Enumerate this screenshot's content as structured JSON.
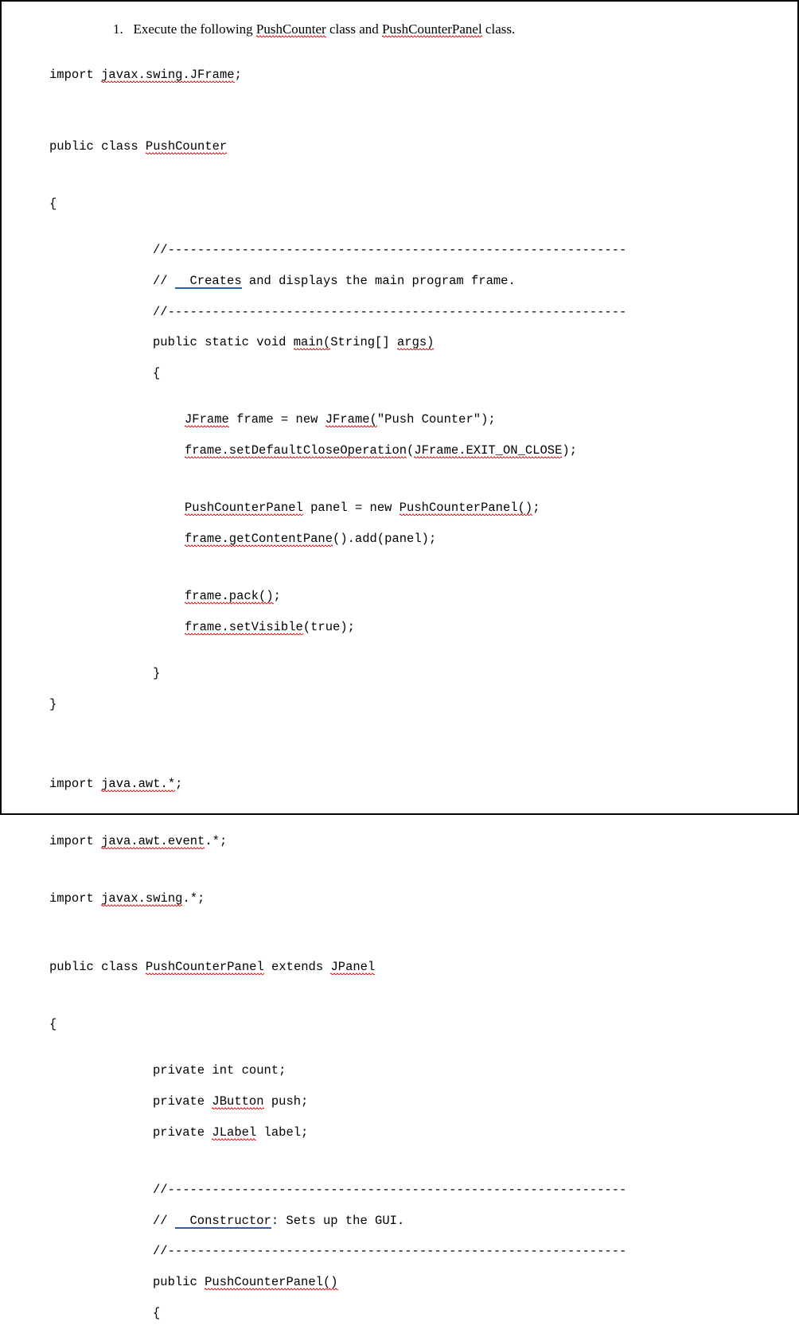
{
  "instruction_number": "1.",
  "instruction_prefix": "Execute the following ",
  "instruction_class1": "PushCounter",
  "instruction_mid": " class and ",
  "instruction_class2": "PushCounterPanel",
  "instruction_suffix": " class.",
  "import1_kw": "import ",
  "import1_pkg": "javax.swing.JFrame",
  "semicolon": ";",
  "class1_decl_pre": "public class ",
  "class1_name": "PushCounter",
  "open_brace": "{",
  "close_brace": "}",
  "div_line_slashes": "//",
  "div_line_dashes": "--------------------------------------------------------------",
  "bl_creates_pre": "// ",
  "bl_creates_link": "  Creates",
  "bl_creates_rest": " and displays the main program frame.",
  "main_sig_pre": "public static void ",
  "main_sig_u": "main(",
  "main_sig_mid": "String[] ",
  "main_sig_args": "args)",
  "jframe_word": "JFrame",
  "jframe_line_mid": " frame = new ",
  "jframe_new": "JFrame(",
  "jframe_line_end": "\"Push Counter\");",
  "setdef_pre": "frame.setDefaultCloseOperation",
  "setdef_mid": "(",
  "jframe_const": "JFrame.EXIT_ON_CLOSE",
  "setdef_end": ");",
  "pcp_word": "PushCounterPanel",
  "pcp_line_mid": " panel = new ",
  "pcp_new": "PushCounterPanel()",
  "pcp_line_end": ";",
  "getcontent_pre": "frame.getContentPane",
  "getcontent_end": "().add(panel);",
  "pack_call": "frame.pack()",
  "pack_end": ";",
  "setvis_call": "frame.setVisible",
  "setvis_end": "(true);",
  "import2_kw": "import ",
  "import2_pkg": "java.awt.*",
  "import3_kw": "import ",
  "import3_pkg": "java.awt.event",
  "import3_rest": ".*;",
  "import4_kw": "import ",
  "import4_pkg": "javax.swing",
  "import4_rest": ".*;",
  "class2_decl_pre": "public class ",
  "class2_name": "PushCounterPanel",
  "class2_extends": " extends ",
  "jpanel": "JPanel",
  "priv_count": "private int count;",
  "priv_push_pre": "private ",
  "jbutton": "JButton",
  "priv_push_rest": " push;",
  "priv_label_pre": "private ",
  "jlabel": "JLabel",
  "priv_label_rest": " label;",
  "bl_ctor_pre": "// ",
  "bl_ctor_link": "  Constructor",
  "bl_ctor_rest": ": Sets up the GUI.",
  "ctor_pre": "public ",
  "ctor_name": "PushCounterPanel()"
}
